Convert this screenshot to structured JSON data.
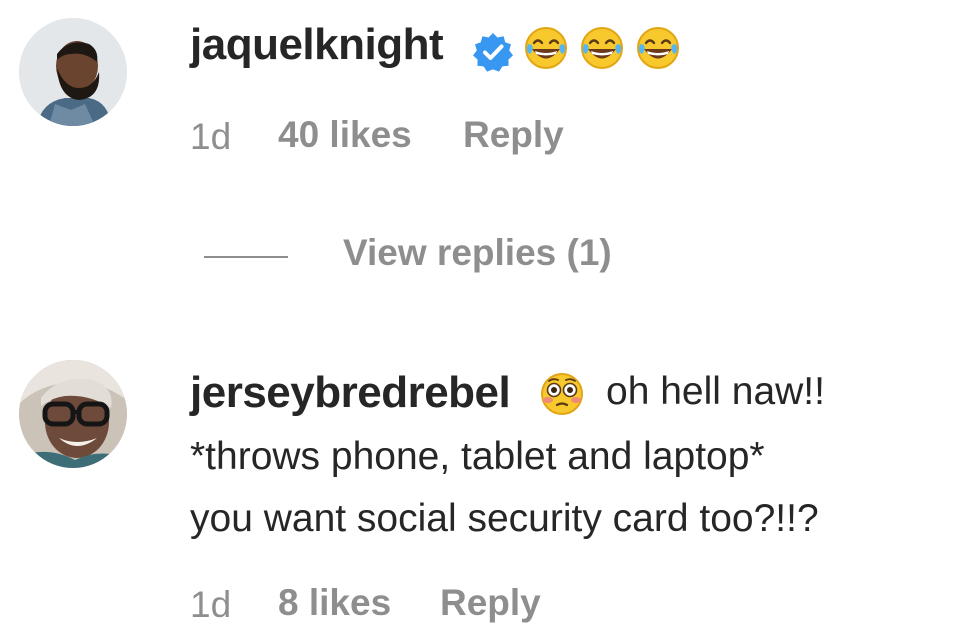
{
  "comments": [
    {
      "username": "jaquelknight",
      "verified": true,
      "text_emojis": [
        "face-with-tears-of-joy-icon",
        "face-with-tears-of-joy-icon",
        "face-with-tears-of-joy-icon"
      ],
      "time": "1d",
      "likes": "40 likes",
      "reply": "Reply",
      "view_replies": "View replies (1)"
    },
    {
      "username": "jerseybredrebel",
      "leading_emoji": "flushed-face-icon",
      "text_lines": [
        "oh hell naw!!",
        "*throws phone, tablet and laptop*",
        "you want social security card too?!!?"
      ],
      "time": "1d",
      "likes": "8 likes",
      "reply": "Reply"
    }
  ],
  "colors": {
    "primary_text": "#262626",
    "secondary_text": "#8e8e8e",
    "verified_badge": "#3897f0"
  }
}
